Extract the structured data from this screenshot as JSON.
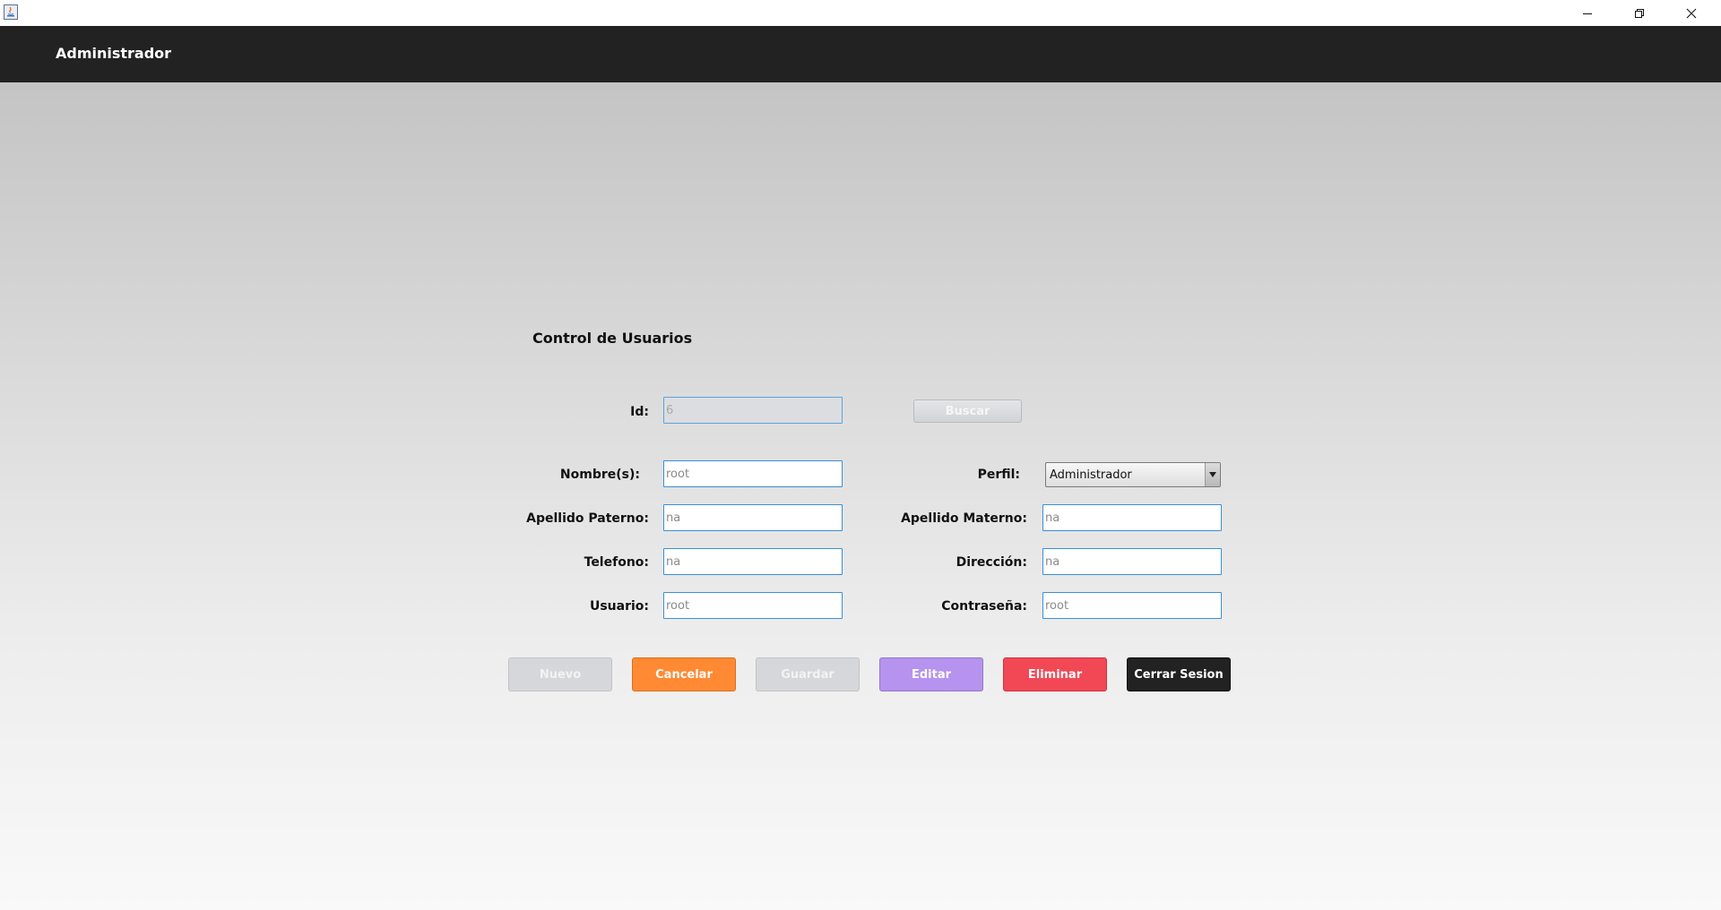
{
  "header": {
    "title": "Administrador"
  },
  "form": {
    "title": "Control de Usuarios",
    "id": {
      "label": "Id:",
      "value": "6"
    },
    "buscar_label": "Buscar",
    "nombre": {
      "label": "Nombre(s):",
      "value": "root"
    },
    "perfil": {
      "label": "Perfil:",
      "selected": "Administrador"
    },
    "apellido_paterno": {
      "label": "Apellido Paterno:",
      "value": "na"
    },
    "apellido_materno": {
      "label": "Apellido Materno:",
      "value": "na"
    },
    "telefono": {
      "label": "Telefono:",
      "value": "na"
    },
    "direccion": {
      "label": "Dirección:",
      "value": "na"
    },
    "usuario": {
      "label": "Usuario:",
      "value": "root"
    },
    "contrasena": {
      "label": "Contraseña:",
      "value": "root"
    }
  },
  "buttons": {
    "nuevo": "Nuevo",
    "cancelar": "Cancelar",
    "guardar": "Guardar",
    "editar": "Editar",
    "eliminar": "Eliminar",
    "cerrar_sesion": "Cerrar Sesion"
  },
  "icons": {
    "app": "java-app-icon",
    "minimize": "minimize-icon",
    "maximize": "restore-icon",
    "close": "close-icon",
    "dropdown": "triangle-down-icon"
  },
  "colors": {
    "header_bg": "#222222",
    "field_border": "#3a8fd6",
    "cancelar": "#ff8a33",
    "editar": "#b693ee",
    "eliminar": "#f24855",
    "cerrar_sesion": "#222222",
    "disabled": "#d6d7da"
  }
}
